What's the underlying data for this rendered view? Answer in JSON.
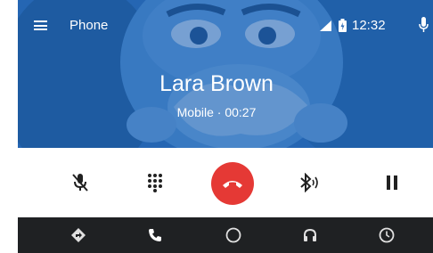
{
  "app_bar": {
    "title": "Phone",
    "time": "12:32",
    "icons": {
      "menu": "hamburger-menu-icon",
      "signal": "cell-signal-icon",
      "battery": "battery-icon",
      "voice": "microphone-icon"
    }
  },
  "call": {
    "caller_name": "Lara Brown",
    "status": "Mobile · 00:27"
  },
  "controls": {
    "items": [
      {
        "name": "mute-mic-icon",
        "label": "mute"
      },
      {
        "name": "dialpad-icon",
        "label": "dialpad"
      },
      {
        "name": "end-call-icon",
        "label": "end call"
      },
      {
        "name": "bluetooth-audio-icon",
        "label": "bluetooth audio"
      },
      {
        "name": "pause-icon",
        "label": "hold"
      }
    ],
    "end_call_color": "#e53935"
  },
  "bottom_nav": {
    "items": [
      "navigation-icon",
      "phone-icon",
      "home-icon",
      "headphones-icon",
      "recents-icon"
    ],
    "background": "#1f2123"
  },
  "colors": {
    "accent_blue": "#2b69b4",
    "end_call_red": "#e53935"
  }
}
